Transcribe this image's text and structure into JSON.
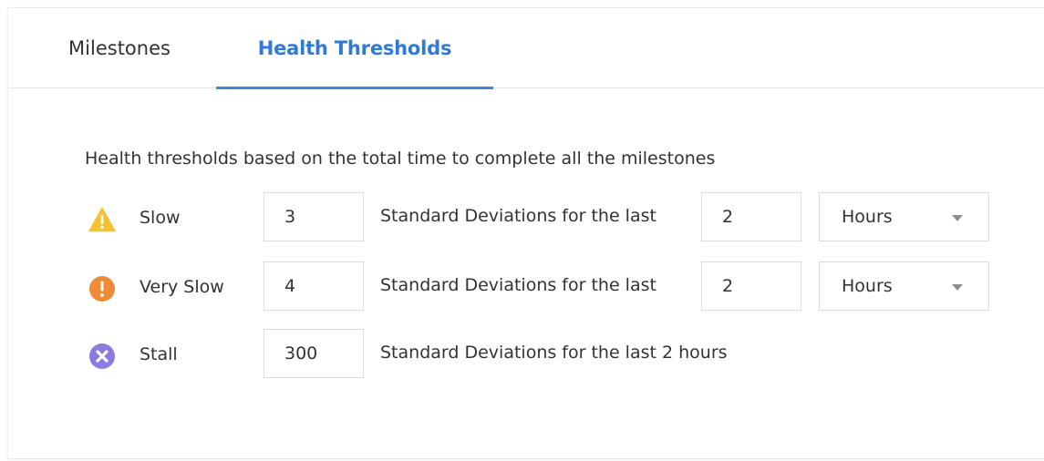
{
  "tabs": [
    {
      "label": "Milestones",
      "active": false
    },
    {
      "label": "Health Thresholds",
      "active": true
    }
  ],
  "description": "Health thresholds based on the total time to complete all the milestones",
  "colors": {
    "accent": "#3d86e0",
    "warning_icon": "#f5c231",
    "very_slow_icon": "#ef8b36",
    "stall_icon": "#8d79e0"
  },
  "thresholds": [
    {
      "icon": "warning-triangle-icon",
      "label": "Slow",
      "std_dev": "3",
      "text": "Standard Deviations for the last",
      "last_value": "2",
      "unit": "Hours"
    },
    {
      "icon": "exclamation-circle-icon",
      "label": "Very Slow",
      "std_dev": "4",
      "text": "Standard Deviations for the last",
      "last_value": "2",
      "unit": "Hours"
    },
    {
      "icon": "x-circle-icon",
      "label": "Stall",
      "std_dev": "300",
      "text": "Standard Deviations for the last 2 hours"
    }
  ]
}
